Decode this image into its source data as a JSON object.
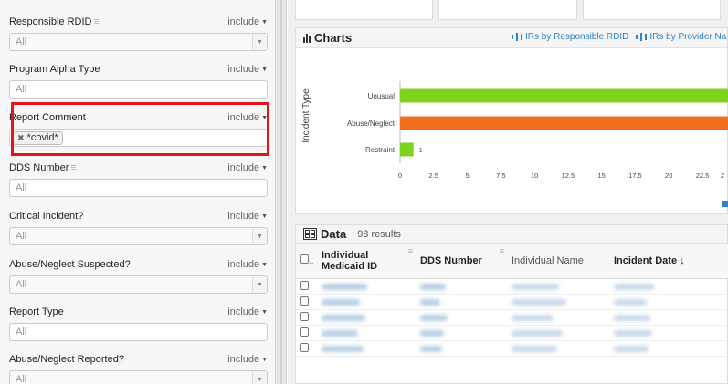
{
  "filters": {
    "include_label": "include",
    "items": [
      {
        "label": "Responsible RDID",
        "value": "All",
        "kind": "select",
        "has_lines": true
      },
      {
        "label": "Program Alpha Type",
        "value": "All",
        "kind": "text",
        "has_lines": false
      },
      {
        "label": "Report Comment",
        "tag": "*covid*",
        "kind": "tags",
        "has_lines": false
      },
      {
        "label": "DDS Number",
        "value": "All",
        "kind": "text",
        "has_lines": true
      },
      {
        "label": "Critical Incident?",
        "value": "All",
        "kind": "select",
        "has_lines": false
      },
      {
        "label": "Abuse/Neglect Suspected?",
        "value": "All",
        "kind": "select",
        "has_lines": false
      },
      {
        "label": "Report Type",
        "value": "All",
        "kind": "text",
        "has_lines": false
      },
      {
        "label": "Abuse/Neglect Reported?",
        "value": "All",
        "kind": "select",
        "has_lines": false
      }
    ]
  },
  "charts": {
    "title": "Charts",
    "tabs": [
      "IRs by Responsible RDID",
      "IRs by Provider Na"
    ],
    "highlight_color": "#e5131d"
  },
  "chart_data": {
    "type": "bar",
    "orientation": "horizontal",
    "ylabel": "Incident Type",
    "categories": [
      "Unusual",
      "Abuse/Neglect",
      "Restraint"
    ],
    "values": [
      28,
      28,
      1
    ],
    "value_labels": [
      "",
      "",
      "1"
    ],
    "colors": [
      "#7ed321",
      "#f26f21",
      "#7ed321"
    ],
    "xticks": [
      "0",
      "2.5",
      "5",
      "7.5",
      "10",
      "12.5",
      "15",
      "17.5",
      "20",
      "22.5",
      "2"
    ],
    "xlim": [
      0,
      22.5
    ],
    "grid": false
  },
  "data": {
    "title": "Data",
    "count": "98 results",
    "columns": {
      "individual_medicaid_id": "Individual Medicaid ID",
      "dds_number": "DDS Number",
      "individual_name": "Individual Name",
      "incident_date": "Incident Date ↓"
    },
    "row_count": 5
  }
}
